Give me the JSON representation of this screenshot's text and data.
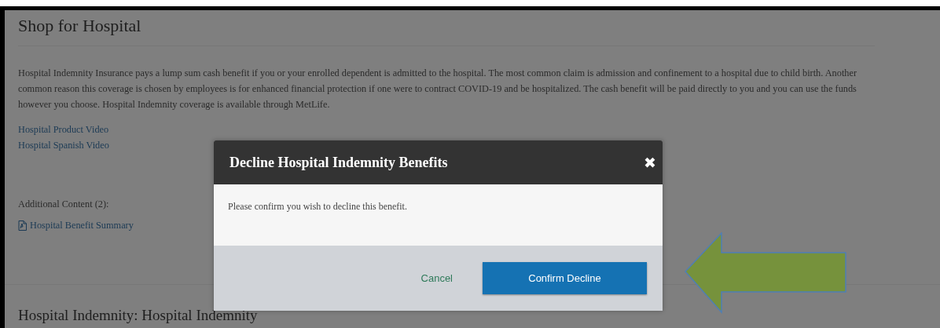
{
  "page": {
    "title": "Shop for Hospital",
    "description": "Hospital Indemnity Insurance pays a lump sum cash benefit if you or your enrolled dependent is admitted to the hospital. The most common claim is admission and confinement to a hospital due to child birth. Another common reason this coverage is chosen by employees is for enhanced financial protection if one were to contract COVID-19 and be hospitalized. The cash benefit will be paid directly to you and you can use the funds however you choose.  Hospital Indemnity coverage is available through MetLife.",
    "video_links": [
      "Hospital Product Video",
      "Hospital Spanish Video"
    ],
    "additional_content_label": "Additional Content (2):",
    "documents": [
      {
        "label": "Hospital Benefit Summary"
      }
    ],
    "next_section_title": "Hospital Indemnity: Hospital Indemnity"
  },
  "modal": {
    "title": "Decline Hospital Indemnity Benefits",
    "close": "✖",
    "message": "Please confirm you wish to decline this benefit.",
    "buttons": [
      {
        "label": "Cancel",
        "kind": "link"
      },
      {
        "label": "Confirm Decline",
        "kind": "primary"
      }
    ]
  }
}
